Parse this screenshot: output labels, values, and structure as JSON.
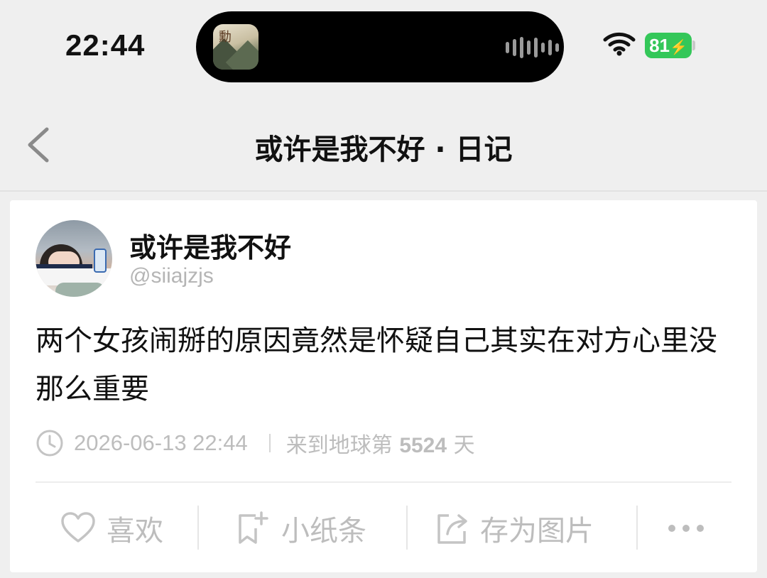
{
  "status_bar": {
    "time": "22:44",
    "battery": "81",
    "icons": [
      "album-art-icon",
      "waveform-icon",
      "wifi-icon",
      "battery-icon"
    ]
  },
  "nav": {
    "title": "或许是我不好 · 日记",
    "back_icon": "chevron-left-icon"
  },
  "post": {
    "author": {
      "name": "或许是我不好",
      "handle": "@siiajzjs"
    },
    "text": "两个女孩闹掰的原因竟然是怀疑自己其实在对方心里没那么重要",
    "datetime": "2026-06-13 22:44",
    "days_prefix": "来到地球第",
    "days_count": "5524",
    "days_suffix": "天"
  },
  "actions": {
    "like_label": "喜欢",
    "note_label": "小纸条",
    "save_image_label": "存为图片",
    "icons": [
      "heart-icon",
      "note-add-icon",
      "share-image-icon",
      "more-icon"
    ]
  },
  "colors": {
    "battery": "#34c759",
    "muted_text": "#bdbdbd",
    "background": "#efefef",
    "card": "#ffffff"
  }
}
